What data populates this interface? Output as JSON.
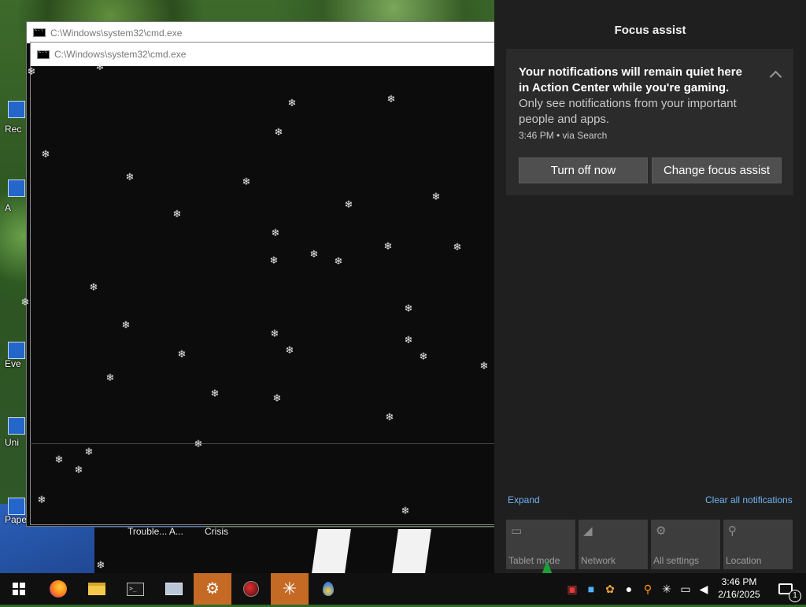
{
  "desktop": {
    "icon_labels": [
      "Rec",
      "A",
      "Eve",
      "Uni",
      "Paper"
    ],
    "under_labels": [
      "Trouble... A...",
      "Crisis"
    ]
  },
  "cmd_windows": {
    "back_title": "C:\\Windows\\system32\\cmd.exe",
    "front_title": "C:\\Windows\\system32\\cmd.exe",
    "snowflake_glyph": "❄"
  },
  "action_center": {
    "title": "Focus assist",
    "notification": {
      "heading": "Your notifications will remain quiet here in Action Center while you're gaming.",
      "body": "Only see notifications from your important people and apps.",
      "meta": "3:46 PM • via Search",
      "buttons": {
        "turn_off": "Turn off now",
        "change": "Change focus assist"
      }
    },
    "expand_label": "Expand",
    "clear_label": "Clear all notifications",
    "quick_actions": [
      {
        "label": "Tablet mode",
        "icon": "tablet-mode-icon"
      },
      {
        "label": "Network",
        "icon": "network-icon"
      },
      {
        "label": "All settings",
        "icon": "settings-icon"
      },
      {
        "label": "Location",
        "icon": "location-icon"
      }
    ]
  },
  "taskbar": {
    "apps": [
      "start",
      "firefox",
      "file-explorer",
      "command-prompt",
      "this-pc",
      "settings",
      "antivirus",
      "snow-app",
      "water-app"
    ],
    "clock_time": "3:46 PM",
    "clock_date": "2/16/2025",
    "notification_count": "1"
  },
  "colors": {
    "action_center_bg": "#1f1f1f",
    "accent_link": "#6fb3f2",
    "taskbar_active": "#c46a24"
  }
}
